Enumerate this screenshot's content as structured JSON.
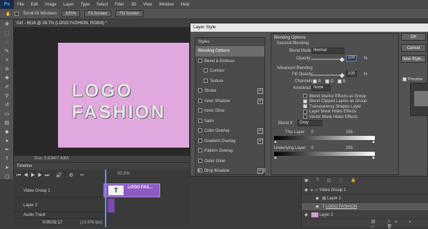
{
  "app": {
    "logo": "Ps",
    "menu": [
      "File",
      "Edit",
      "Image",
      "Layer",
      "Type",
      "Select",
      "Filter",
      "3D",
      "View",
      "Window",
      "Help"
    ]
  },
  "options": {
    "scroll_all": "Scroll All Windows",
    "zoom": "100%",
    "fit_screen": "Fit Screen",
    "fill_screen": "Fill Screen"
  },
  "document": {
    "tab": "Girl - 6516 @ 28.7% (LOGO FASHION, RGB/8) *",
    "artwork_text": "LOGO FASHION",
    "status": "Doc: 5.93M/7.83M",
    "bg_color": "#e0a8de"
  },
  "timeline": {
    "title": "Timeline",
    "time_label": "00:20s",
    "rows": [
      "Video Group 1",
      "Layer 2",
      "Audio Track"
    ],
    "clip_label": "LOGO FAS...",
    "clip_glyph": "T",
    "timecode": "0:00:02:17",
    "fps": "(23.976 fps)"
  },
  "dialog": {
    "title": "Layer Style",
    "styles_header": "Styles",
    "items": [
      {
        "label": "Blending Options",
        "selected": true,
        "checkbox": false,
        "plus": false
      },
      {
        "label": "Bevel & Emboss",
        "selected": false,
        "checkbox": true,
        "plus": false
      },
      {
        "label": "Contour",
        "selected": false,
        "checkbox": true,
        "plus": false,
        "indent": true
      },
      {
        "label": "Texture",
        "selected": false,
        "checkbox": true,
        "plus": false,
        "indent": true
      },
      {
        "label": "Stroke",
        "selected": false,
        "checkbox": true,
        "plus": true
      },
      {
        "label": "Inner Shadow",
        "selected": false,
        "checkbox": true,
        "plus": true
      },
      {
        "label": "Inner Glow",
        "selected": false,
        "checkbox": true,
        "plus": false
      },
      {
        "label": "Satin",
        "selected": false,
        "checkbox": true,
        "plus": false
      },
      {
        "label": "Color Overlay",
        "selected": false,
        "checkbox": true,
        "plus": true
      },
      {
        "label": "Gradient Overlay",
        "selected": false,
        "checkbox": true,
        "plus": true
      },
      {
        "label": "Pattern Overlay",
        "selected": false,
        "checkbox": true,
        "plus": false
      },
      {
        "label": "Outer Glow",
        "selected": false,
        "checkbox": true,
        "plus": false
      },
      {
        "label": "Drop Shadow",
        "selected": false,
        "checkbox": true,
        "plus": true
      }
    ],
    "fx": "fx",
    "blending_options": "Blending Options",
    "general_blending": "General Blending",
    "blend_mode_label": "Blend Mode:",
    "blend_mode": "Normal",
    "opacity_label": "Opacity:",
    "opacity": "100",
    "opacity_unit": "%",
    "advanced_blending": "Advanced Blending",
    "fill_opacity_label": "Fill Opacity:",
    "fill_opacity": "100",
    "channels_label": "Channels:",
    "channels": [
      "R",
      "G",
      "B"
    ],
    "knockout_label": "Knockout:",
    "knockout": "None",
    "adv_checks": [
      {
        "label": "Blend Interior Effects as Group",
        "on": false
      },
      {
        "label": "Blend Clipped Layers as Group",
        "on": true
      },
      {
        "label": "Transparency Shapes Layer",
        "on": true
      },
      {
        "label": "Layer Mask Hides Effects",
        "on": false
      },
      {
        "label": "Vector Mask Hides Effects",
        "on": false
      }
    ],
    "blend_if_label": "Blend If:",
    "blend_if": "Gray",
    "this_layer_label": "This Layer:",
    "this_layer_min": "0",
    "this_layer_max": "255",
    "underlying_label": "Underlying Layer:",
    "underlying_min": "0",
    "underlying_max": "255",
    "buttons": [
      "OK",
      "Cancel",
      "New Style...",
      "Preview"
    ]
  },
  "layers": {
    "rows": [
      "Video Group 1",
      "Layer 1",
      "LOGO FASHION",
      "Layer 2"
    ]
  }
}
